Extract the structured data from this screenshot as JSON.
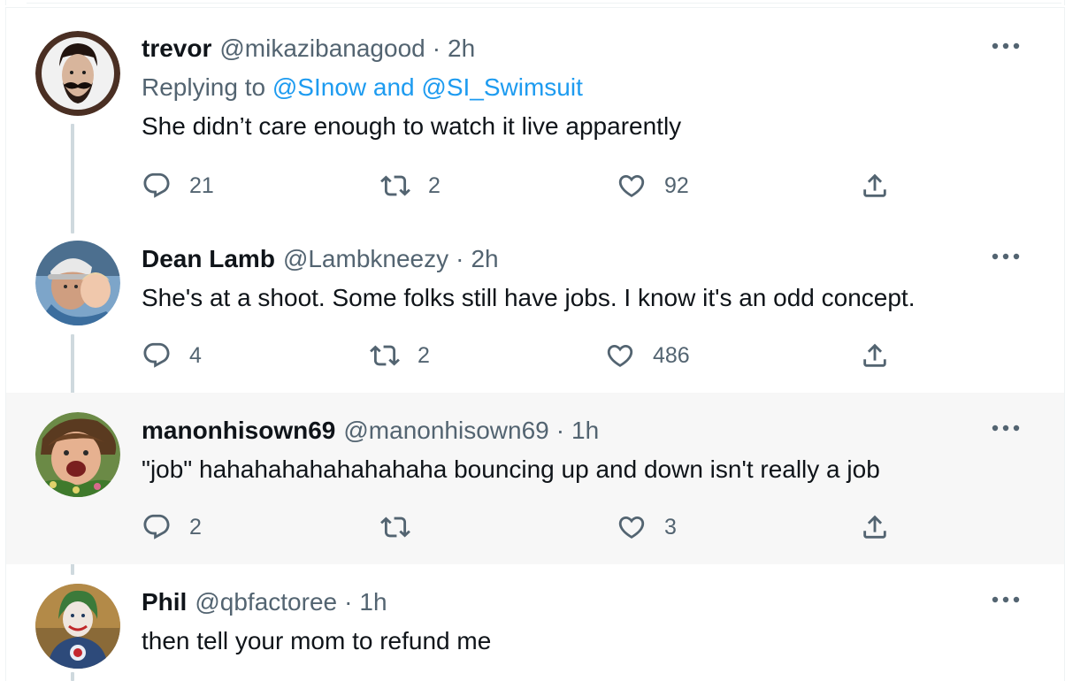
{
  "colors": {
    "text": "#0f1419",
    "muted": "#536471",
    "link": "#1d9bf0",
    "thread_line": "#cfd9de",
    "highlight_bg": "#f7f7f7"
  },
  "icons": {
    "reply": "reply-icon",
    "retweet": "retweet-icon",
    "like": "heart-icon",
    "share": "share-icon",
    "more": "more-icon"
  },
  "tweets": [
    {
      "name": "trevor",
      "handle": "@mikazibanagood",
      "dot": "·",
      "time": "2h",
      "replying_prefix": "Replying to",
      "replying_to": "@SInow and @SI_Swimsuit",
      "text": "She didn’t care enough to watch it live apparently",
      "replies": "21",
      "retweets": "2",
      "likes": "92"
    },
    {
      "name": "Dean Lamb",
      "handle": "@Lambkneezy",
      "dot": "·",
      "time": "2h",
      "text": "She's at a shoot. Some folks still have jobs. I know it's an odd concept.",
      "replies": "4",
      "retweets": "2",
      "likes": "486"
    },
    {
      "name": "manonhisown69",
      "handle": "@manonhisown69",
      "dot": "·",
      "time": "1h",
      "text": "\"job\" hahahahahahahahaha bouncing up and down isn't really a job",
      "replies": "2",
      "retweets": "",
      "likes": "3"
    },
    {
      "name": "Phil",
      "handle": "@qbfactoree",
      "dot": "·",
      "time": "1h",
      "text": "then tell your mom to refund me"
    }
  ]
}
